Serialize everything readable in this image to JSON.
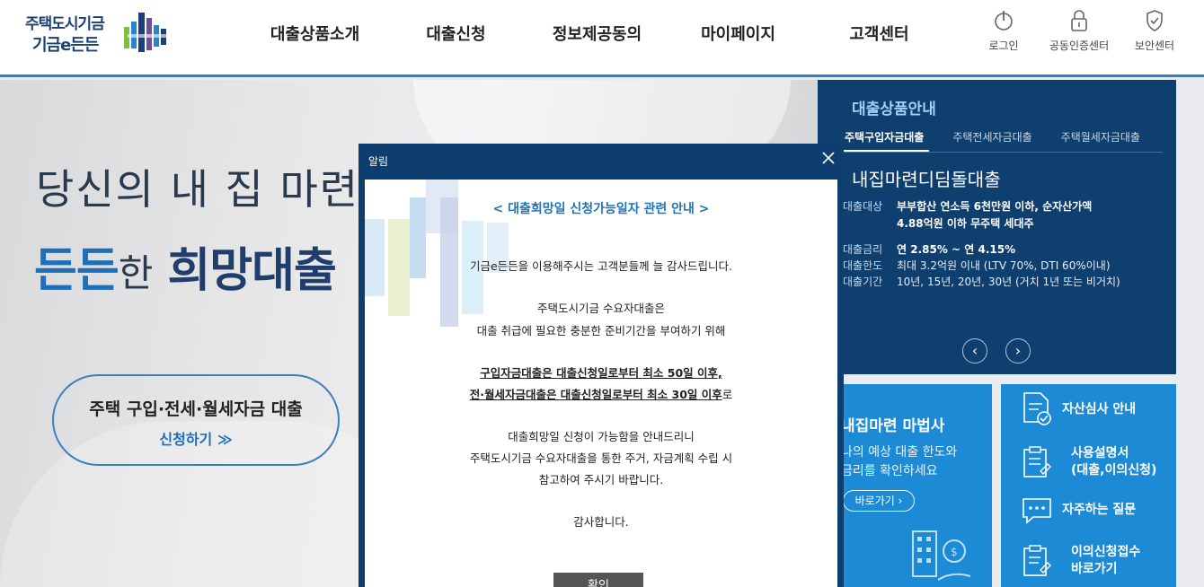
{
  "brand": {
    "line1": "주택도시기금",
    "line2": "기금e든든"
  },
  "gnb": [
    "대출상품소개",
    "대출신청",
    "정보제공동의",
    "마이페이지",
    "고객센터"
  ],
  "util": [
    {
      "label": "로그인",
      "icon": "power-icon"
    },
    {
      "label": "공동인증센터",
      "icon": "lock-icon"
    },
    {
      "label": "보안센터",
      "icon": "shield-icon"
    }
  ],
  "hero": {
    "line1": "당신의 내 집 마련",
    "line2_a": "든든",
    "line2_b": "한",
    "line2_c": "희망대출",
    "button_title": "주택 구입·전세·월세자금 대출",
    "button_sub": "신청하기 ≫"
  },
  "product": {
    "title": "대출상품안내",
    "tabs": [
      "주택구입자금대출",
      "주택전세자금대출",
      "주택월세자금대출"
    ],
    "active_tab": 0,
    "name": "내집마련디딤돌대출",
    "rows": [
      {
        "k": "대출대상",
        "v": "부부합산 연소득 6천만원 이하, 순자산가액",
        "v2": "4.88억원 이하  무주택 세대주"
      },
      {
        "k": "대출금리",
        "v": "연 2.85% ~ 연 4.15%"
      },
      {
        "k": "대출한도",
        "v": "최대 3.2억원 이내 (LTV 70%, DTI 60%이내)"
      },
      {
        "k": "대출기간",
        "v": "10년, 15년, 20년, 30년 (거치 1년 또는 비거치)"
      }
    ],
    "prev": "‹",
    "next": "›"
  },
  "magic": {
    "title": "내집마련 마법사",
    "desc1": "나의 예상 대출 한도와",
    "desc2": "금리를 확인하세요",
    "button": "바로가기 ›"
  },
  "menu": [
    {
      "label": "자산심사 안내",
      "label2": ""
    },
    {
      "label": "사용설명서",
      "label2": "(대출,이의신청)"
    },
    {
      "label": "자주하는 질문",
      "label2": ""
    },
    {
      "label": "이의신청접수",
      "label2": "바로가기"
    }
  ],
  "modal": {
    "header": "알림",
    "title": "< 대출희망일 신청가능일자 관련 안내 >",
    "p1": "기금e든든을 이용해주시는 고객분들께 늘 감사드립니다.",
    "p2a": "주택도시기금 수요자대출은",
    "p2b": "대출 취급에 필요한 충분한 준비기간을 부여하기 위해",
    "p3a": "구입자금대출은 대출신청일로부터 최소 50일 이후,",
    "p3b": "전·월세자금대출은 대출신청일로부터 최소 30일 이후",
    "p3b_tail": "로",
    "p4a": "대출희망일 신청이 가능함을 안내드리니",
    "p4b": "주택도시기금 수요자대출을 통한 주거, 자금계획 수립 시",
    "p4c": "참고하여 주시기 바랍니다.",
    "p5": "감사합니다.",
    "ok": "확인"
  }
}
